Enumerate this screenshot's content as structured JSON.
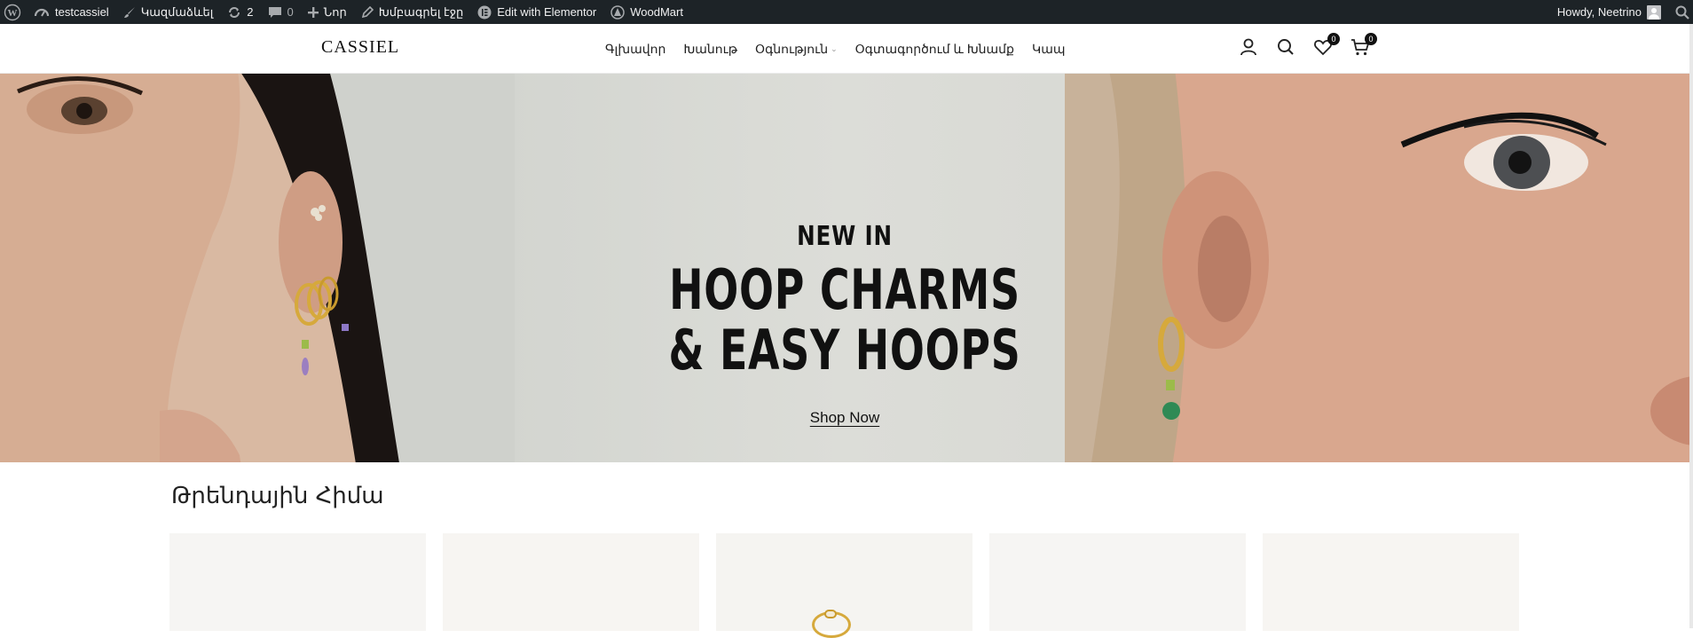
{
  "admin_bar": {
    "site_name": "testcassiel",
    "customize": "Կազմաձևել",
    "updates_count": "2",
    "comments_count": "0",
    "new_label": "Նոր",
    "edit_page": "Խմբագրել էջը",
    "edit_elementor": "Edit with Elementor",
    "woodmart": "WoodMart",
    "howdy": "Howdy, Neetrino",
    "icons": [
      "wordpress-icon",
      "dashboard-icon",
      "brush-icon",
      "updates-icon",
      "comment-icon",
      "plus-icon",
      "pencil-icon",
      "elementor-icon",
      "woodmart-icon",
      "avatar",
      "search-icon"
    ]
  },
  "header": {
    "logo": "CASSIEL",
    "nav": [
      {
        "label": "Գլխավոր"
      },
      {
        "label": "Խանութ"
      },
      {
        "label": "Օգնություն",
        "has_dropdown": true
      },
      {
        "label": "Օգտագործում և Խնամք"
      },
      {
        "label": "Կապ"
      }
    ],
    "wishlist_count": "0",
    "cart_count": "0",
    "icons": [
      "user-icon",
      "search-icon",
      "heart-icon",
      "cart-icon"
    ]
  },
  "hero": {
    "kicker": "NEW IN",
    "title_line1": "HOOP CHARMS",
    "title_line2": "& EASY HOOPS",
    "cta": "Shop Now"
  },
  "trending": {
    "title": "Թրենդային Հիմա",
    "product_count_visible": 5
  },
  "colors": {
    "admin_bar_bg": "#1d2327",
    "text": "#111111",
    "gold": "#d6a93c"
  }
}
